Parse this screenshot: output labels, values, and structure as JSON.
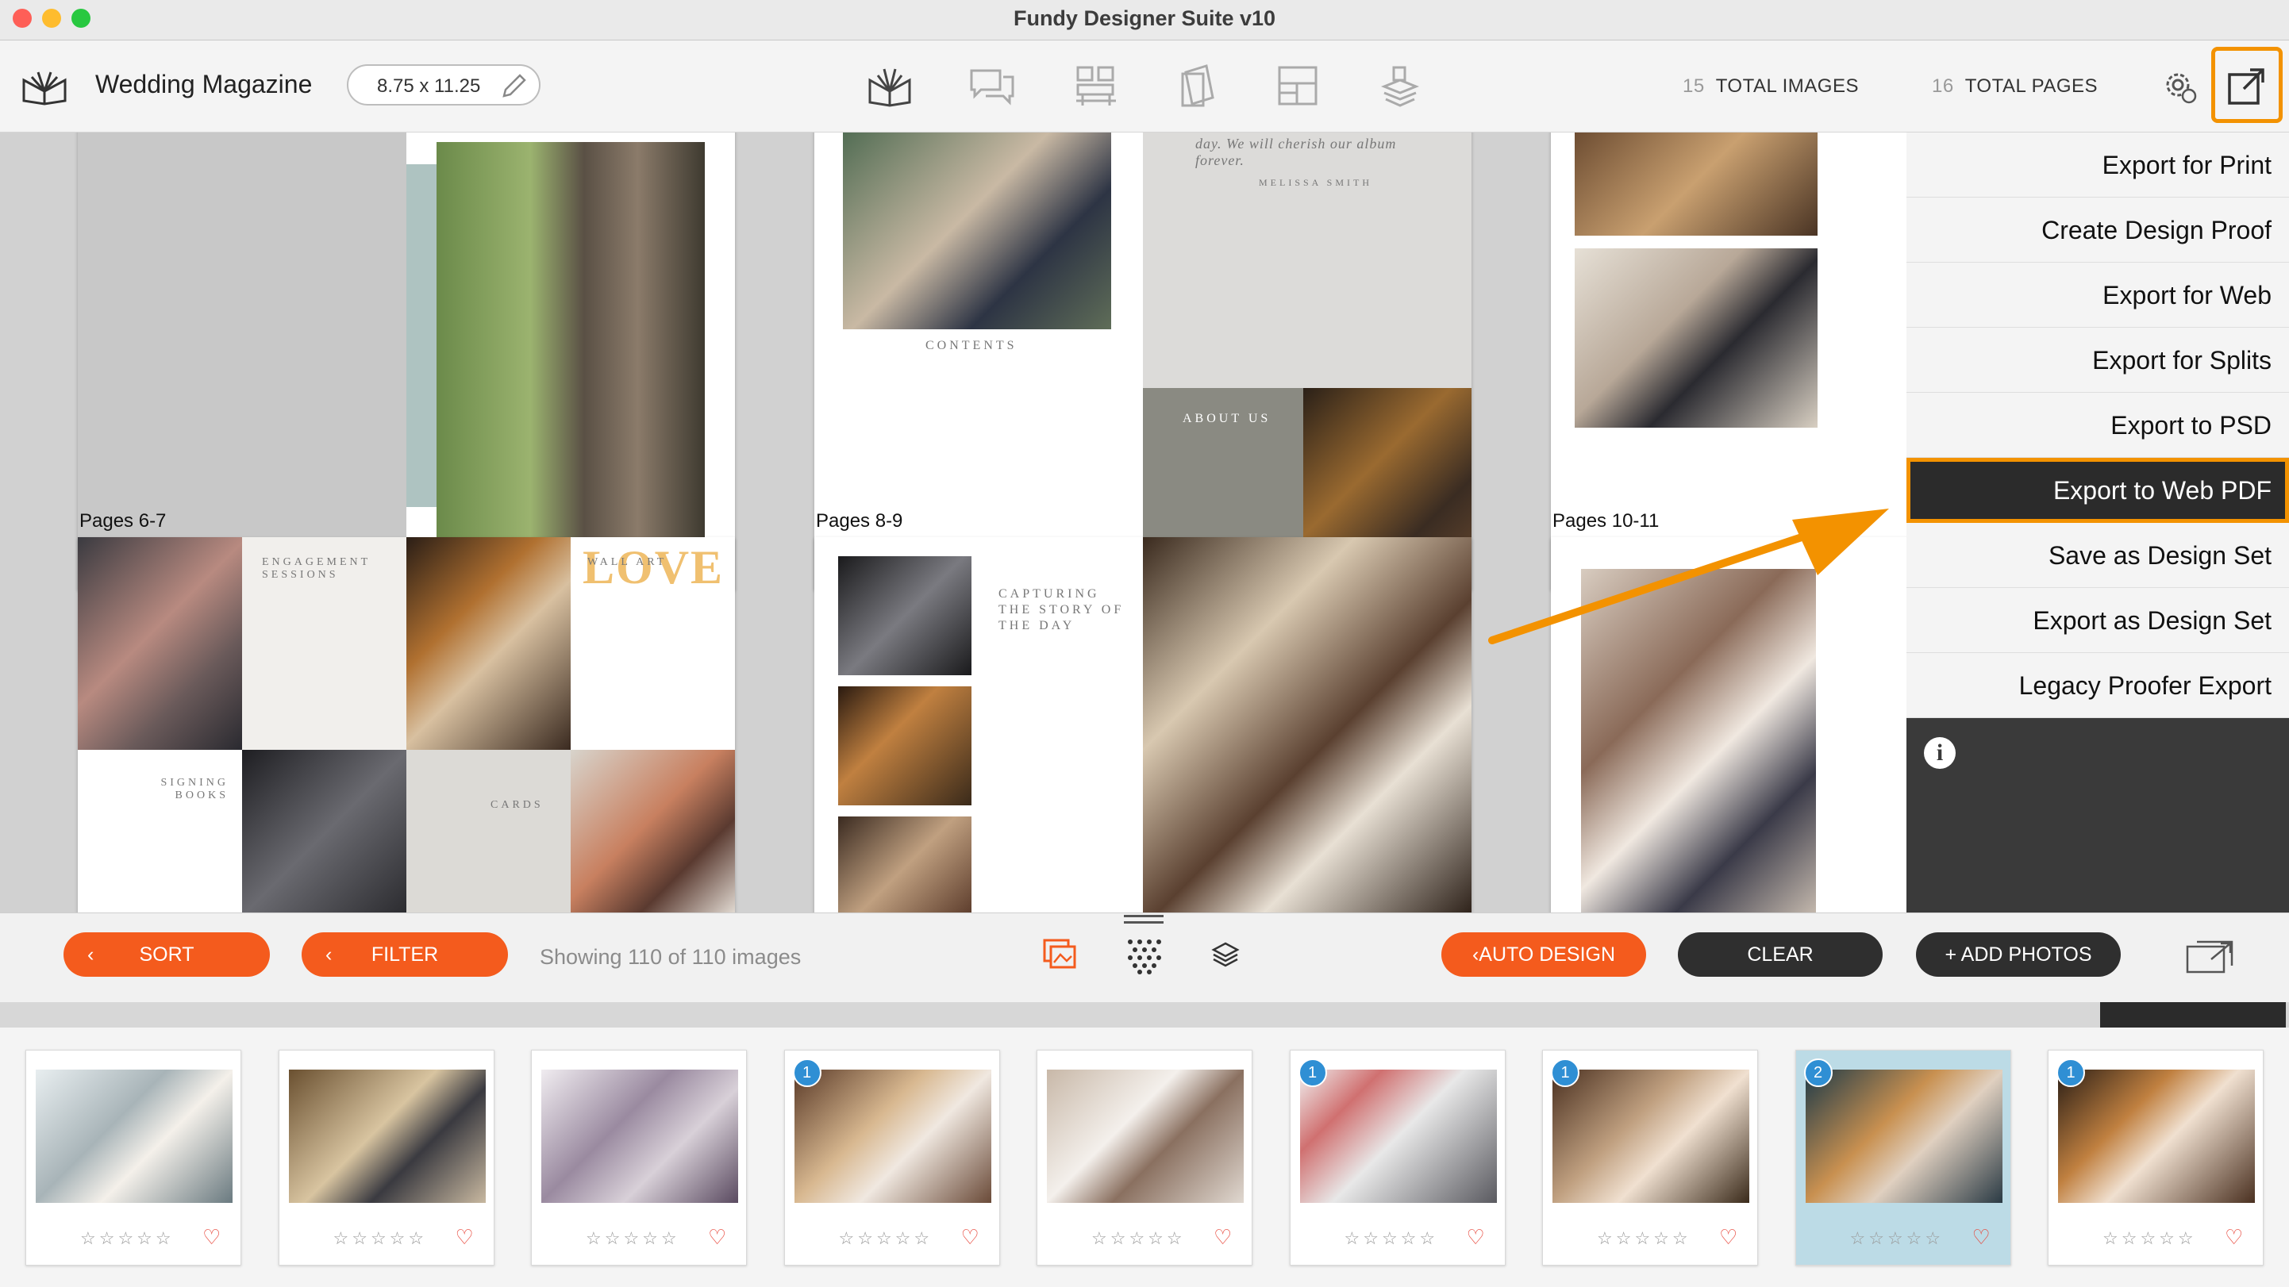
{
  "window": {
    "title": "Fundy Designer Suite v10"
  },
  "toolbar": {
    "project_name": "Wedding Magazine",
    "album_size": "8.75 x 11.25",
    "total_images_count": "15",
    "total_images_label": "TOTAL IMAGES",
    "total_pages_count": "16",
    "total_pages_label": "TOTAL PAGES"
  },
  "spreads": {
    "contents_heading": "CONTENTS",
    "about_heading": "ABOUT US",
    "quote_text": "day. We will cherish our album forever.",
    "quote_author": "MELISSA SMITH",
    "label_6_7": "Pages 6-7",
    "label_8_9": "Pages 8-9",
    "label_10_11": "Pages 10-11",
    "engagement_heading": "ENGAGEMENT SESSIONS",
    "wall_art_heading": "WALL ART",
    "signing_books_heading": "SIGNING BOOKS",
    "cards_heading": "CARDS",
    "capturing_heading": "CAPTURING THE STORY OF THE DAY",
    "love_sign": "LOVE"
  },
  "export_menu": {
    "items": [
      "Export for Print",
      "Create Design Proof",
      "Export for Web",
      "Export for Splits",
      "Export to PSD",
      "Export to Web PDF",
      "Save as Design Set",
      "Export as Design Set",
      "Legacy Proofer Export"
    ],
    "selected": "Export to Web PDF",
    "info_glyph": "i"
  },
  "bottom_bar": {
    "sort_label": "SORT",
    "filter_label": "FILTER",
    "showing_text": "Showing 110 of 110 images",
    "auto_design_label": "AUTO DESIGN",
    "clear_label": "CLEAR",
    "add_photos_label": "+ ADD PHOTOS"
  },
  "filmstrip": {
    "rating_stars": "☆☆☆☆☆",
    "heart": "♡",
    "thumbs": [
      {
        "badge": "",
        "selected": false
      },
      {
        "badge": "",
        "selected": false
      },
      {
        "badge": "",
        "selected": false
      },
      {
        "badge": "1",
        "selected": false
      },
      {
        "badge": "",
        "selected": false
      },
      {
        "badge": "1",
        "selected": false
      },
      {
        "badge": "1",
        "selected": false
      },
      {
        "badge": "2",
        "selected": true
      },
      {
        "badge": "1",
        "selected": false
      }
    ]
  },
  "colors": {
    "accent_orange": "#f39200",
    "button_orange": "#f45b1d",
    "dark_button": "#2f2f2f",
    "badge_blue": "#2f8fd4"
  }
}
